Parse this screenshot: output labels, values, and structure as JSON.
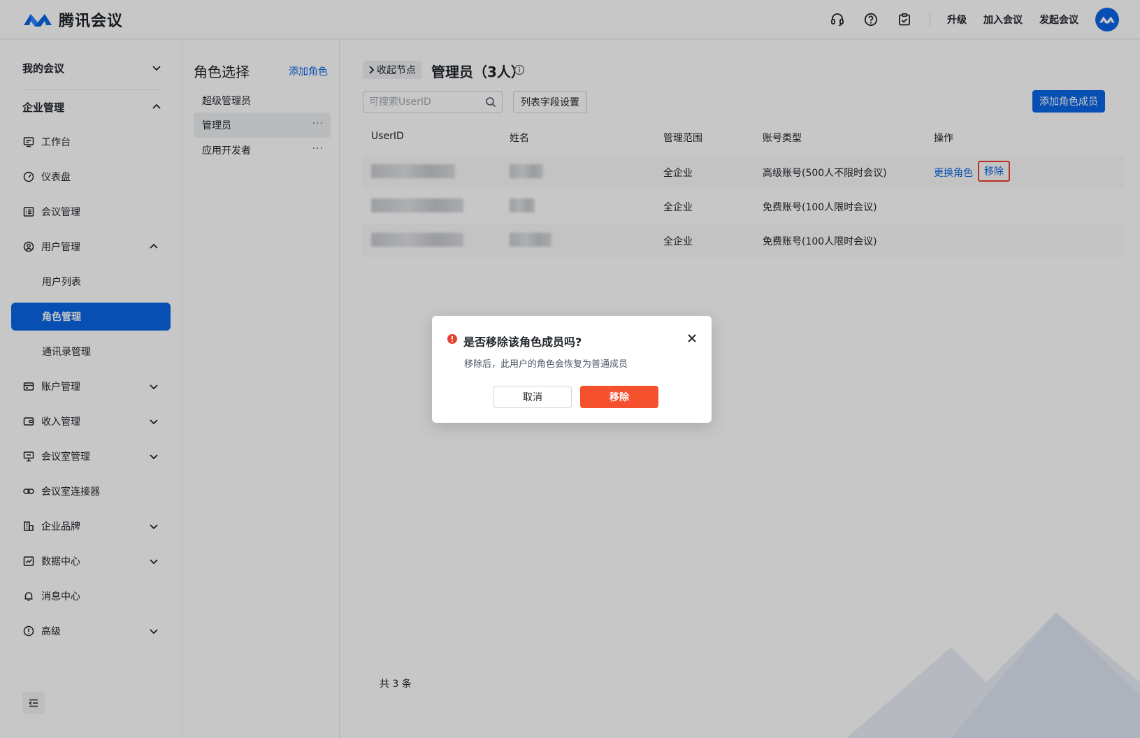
{
  "app": {
    "name": "腾讯会议",
    "brand_color": "#0a66e6",
    "danger_color": "#f5512f"
  },
  "topbar": {
    "icons": [
      "headset-icon",
      "help-icon",
      "clipboard-check-icon"
    ],
    "upgrade": "升级",
    "join_meeting": "加入会议",
    "start_meeting": "发起会议"
  },
  "sidebar": {
    "my_meetings": "我的会议",
    "enterprise_mgmt": "企业管理",
    "items": {
      "workbench": "工作台",
      "dashboard": "仪表盘",
      "meeting_mgmt": "会议管理",
      "user_mgmt": "用户管理",
      "user_list": "用户列表",
      "role_mgmt": "角色管理",
      "contacts_mgmt": "通讯录管理",
      "account_mgmt": "账户管理",
      "revenue_mgmt": "收入管理",
      "room_mgmt": "会议室管理",
      "room_connector": "会议室连接器",
      "brand": "企业品牌",
      "data_center": "数据中心",
      "message_center": "消息中心",
      "advanced": "高级"
    },
    "active": "角色管理"
  },
  "roles": {
    "title": "角色选择",
    "add_label": "添加角色",
    "list": [
      "超级管理员",
      "管理员",
      "应用开发者"
    ],
    "selected": "管理员"
  },
  "main": {
    "collapse_label": "收起节点",
    "title": "管理员（3人）",
    "search_placeholder": "可搜索UserID",
    "field_settings": "列表字段设置",
    "add_member": "添加角色成员",
    "columns": [
      "UserID",
      "姓名",
      "管理范围",
      "账号类型",
      "操作"
    ],
    "rows": [
      {
        "scope": "全企业",
        "account_type": "高级账号(500人不限时会议)"
      },
      {
        "scope": "全企业",
        "account_type": "免费账号(100人限时会议)"
      },
      {
        "scope": "全企业",
        "account_type": "免费账号(100人限时会议)"
      }
    ],
    "ops": {
      "change_role": "更换角色",
      "remove": "移除"
    },
    "total": "共 3 条"
  },
  "modal": {
    "title": "是否移除该角色成员吗?",
    "description": "移除后，此用户的角色会恢复为普通成员",
    "cancel": "取消",
    "confirm": "移除"
  }
}
